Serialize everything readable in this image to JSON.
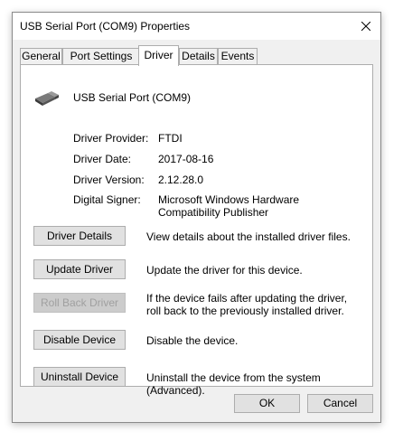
{
  "window": {
    "title": "USB Serial Port (COM9) Properties"
  },
  "tabs": [
    {
      "label": "General"
    },
    {
      "label": "Port Settings"
    },
    {
      "label": "Driver"
    },
    {
      "label": "Details"
    },
    {
      "label": "Events"
    }
  ],
  "active_tab": "Driver",
  "device": {
    "name": "USB Serial Port (COM9)",
    "icon": "usb-plug-icon"
  },
  "properties": [
    {
      "label": "Driver Provider:",
      "value": "FTDI"
    },
    {
      "label": "Driver Date:",
      "value": "2017-08-16"
    },
    {
      "label": "Driver Version:",
      "value": "2.12.28.0"
    },
    {
      "label": "Digital Signer:",
      "value": "Microsoft Windows Hardware Compatibility Publisher"
    }
  ],
  "actions": [
    {
      "label": "Driver Details",
      "description": "View details about the installed driver files.",
      "enabled": true
    },
    {
      "label": "Update Driver",
      "description": "Update the driver for this device.",
      "enabled": true
    },
    {
      "label": "Roll Back Driver",
      "description": "If the device fails after updating the driver, roll back to the previously installed driver.",
      "enabled": false
    },
    {
      "label": "Disable Device",
      "description": "Disable the device.",
      "enabled": true
    },
    {
      "label": "Uninstall Device",
      "description": "Uninstall the device from the system (Advanced).",
      "enabled": true
    }
  ],
  "footer": {
    "ok_label": "OK",
    "cancel_label": "Cancel"
  }
}
